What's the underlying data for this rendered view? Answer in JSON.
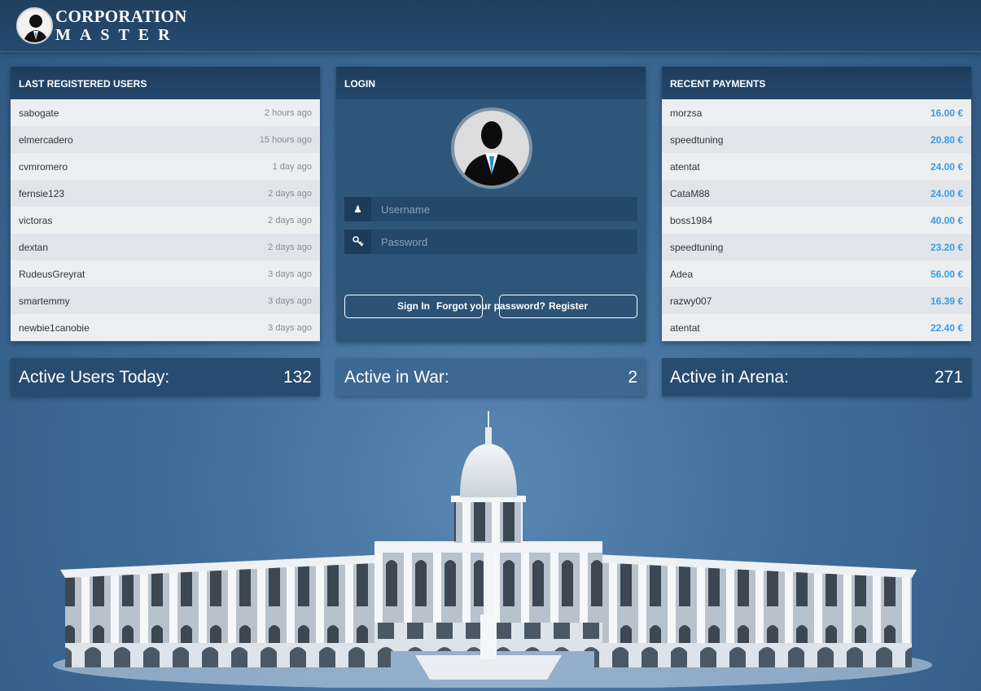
{
  "logo": {
    "line1": "CORPORATION",
    "line2": "MASTER"
  },
  "registered": {
    "title": "LAST REGISTERED USERS",
    "users": [
      {
        "name": "sabogate",
        "time": "2 hours ago"
      },
      {
        "name": "elmercadero",
        "time": "15 hours ago"
      },
      {
        "name": "cvmromero",
        "time": "1 day ago"
      },
      {
        "name": "fernsie123",
        "time": "2 days ago"
      },
      {
        "name": "victoras",
        "time": "2 days ago"
      },
      {
        "name": "dextan",
        "time": "2 days ago"
      },
      {
        "name": "RudeusGreyrat",
        "time": "3 days ago"
      },
      {
        "name": "smartemmy",
        "time": "3 days ago"
      },
      {
        "name": "newbie1canobie",
        "time": "3 days ago"
      }
    ]
  },
  "login": {
    "title": "LOGIN",
    "username_placeholder": "Username",
    "password_placeholder": "Password",
    "signin_label": "Sign In",
    "register_label": "Register",
    "forgot_label": "Forgot your password?"
  },
  "payments": {
    "title": "RECENT PAYMENTS",
    "items": [
      {
        "name": "morzsa",
        "amount": "16.00 €"
      },
      {
        "name": "speedtuning",
        "amount": "20.80 €"
      },
      {
        "name": "atentat",
        "amount": "24.00 €"
      },
      {
        "name": "CataM88",
        "amount": "24.00 €"
      },
      {
        "name": "boss1984",
        "amount": "40.00 €"
      },
      {
        "name": "speedtuning",
        "amount": "23.20 €"
      },
      {
        "name": "Adea",
        "amount": "56.00 €"
      },
      {
        "name": "razwy007",
        "amount": "16.39 €"
      },
      {
        "name": "atentat",
        "amount": "22.40 €"
      }
    ]
  },
  "stats": {
    "users_today_label": "Active Users Today:",
    "users_today_value": "132",
    "war_label": "Active in War:",
    "war_value": "2",
    "arena_label": "Active in Arena:",
    "arena_value": "271"
  },
  "colors": {
    "accent": "#3c9ae0",
    "header": "#20405f",
    "panel_head": "#1e3d5c"
  }
}
